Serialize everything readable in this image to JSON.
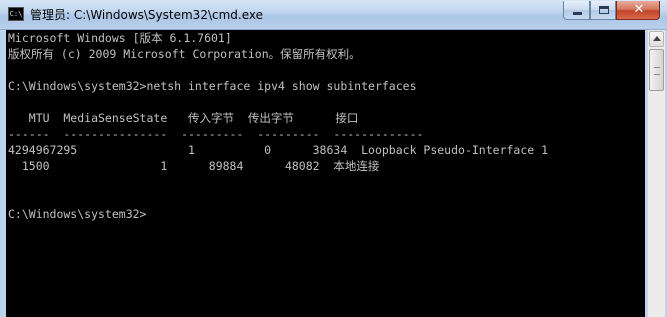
{
  "window": {
    "title": "管理员: C:\\Windows\\System32\\cmd.exe",
    "icon": "cmd-icon",
    "icon_label": "C:\\",
    "controls": {
      "minimize": "minimize-icon",
      "maximize": "maximize-icon",
      "close_glyph": "✕"
    }
  },
  "console": {
    "lines": [
      "Microsoft Windows [版本 6.1.7601]",
      "版权所有 (c) 2009 Microsoft Corporation。保留所有权利。",
      "",
      "C:\\Windows\\system32>netsh interface ipv4 show subinterfaces",
      "",
      "   MTU  MediaSenseState   传入字节  传出字节      接口",
      "------  ---------------  ---------  ---------  -------------",
      "4294967295                1          0      38634  Loopback Pseudo-Interface 1",
      "  1500                1      89884      48082  本地连接",
      "",
      "",
      "",
      "C:\\Windows\\system32>"
    ],
    "text_color": "#c0c0c0",
    "background": "#000000"
  }
}
